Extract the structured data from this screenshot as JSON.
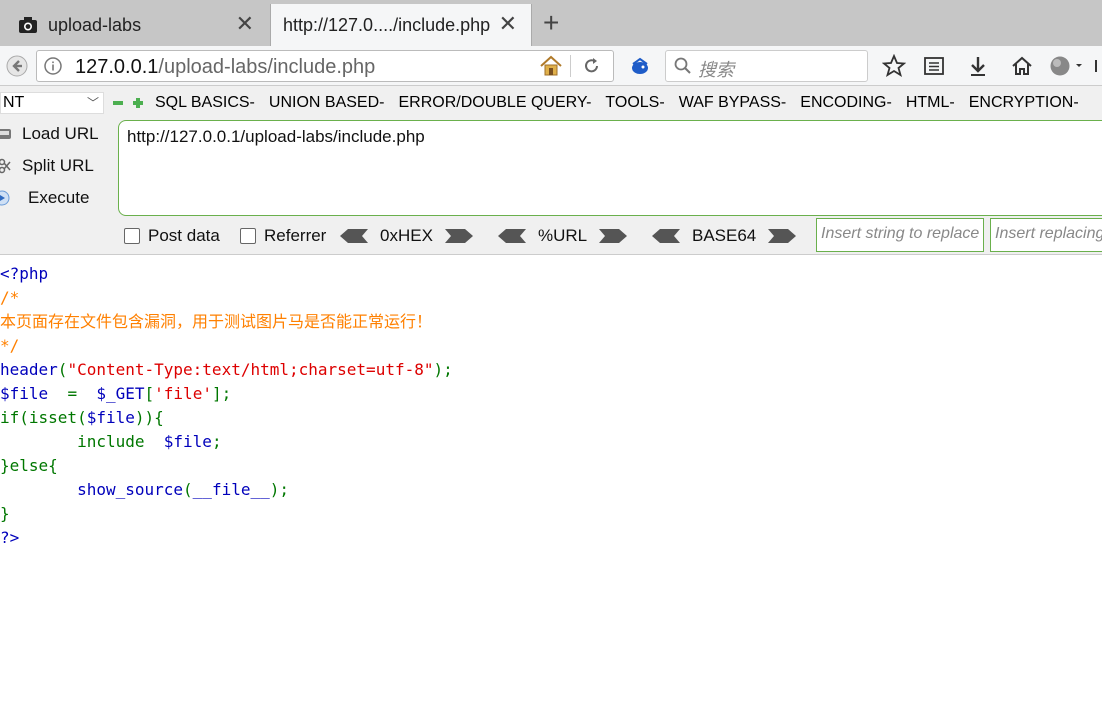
{
  "tabs": [
    {
      "title": "upload-labs"
    },
    {
      "title": "http://127.0..../include.php"
    }
  ],
  "nav": {
    "url_host": "127.0.0.1",
    "url_path": "/upload-labs/include.php",
    "search_placeholder": "搜索"
  },
  "hackbar": {
    "select_value": "NT",
    "menu": [
      "SQL BASICS-",
      "UNION BASED-",
      "ERROR/DOUBLE QUERY-",
      "TOOLS-",
      "WAF BYPASS-",
      "ENCODING-",
      "HTML-",
      "ENCRYPTION-"
    ],
    "load_url": "Load URL",
    "split_url": "Split URL",
    "execute": "Execute",
    "url_value": "http://127.0.0.1/upload-labs/include.php",
    "post_data": "Post data",
    "referrer": "Referrer",
    "hex": "0xHEX",
    "url_enc": "%URL",
    "base64": "BASE64",
    "replace_ph": "Insert string to replace",
    "replacing_ph": "Insert replacing string"
  },
  "code": {
    "l1": "<?php",
    "l2": "/*",
    "l3": "本页面存在文件包含漏洞，用于测试图片马是否能正常运行！",
    "l4": "*/",
    "l5_fn": "header",
    "l5_str": "\"Content-Type:text/html;charset=utf-8\"",
    "l6_var": "$file",
    "l6_eq": "  =  ",
    "l6_get": "$_GET",
    "l6_key": "'file'",
    "l7_kw": "if(isset(",
    "l7_var": "$file",
    "l7_end": ")){",
    "l8_kw": "include",
    "l8_var": "$file",
    "l9": "}else{",
    "l10_fn": "show_source",
    "l10_arg": "__file__",
    "l11": "}",
    "l12": "?>"
  },
  "colors": {
    "keyword": "#007700",
    "string": "#dd0000",
    "comment": "#ff8000",
    "default": "#0000bb"
  }
}
